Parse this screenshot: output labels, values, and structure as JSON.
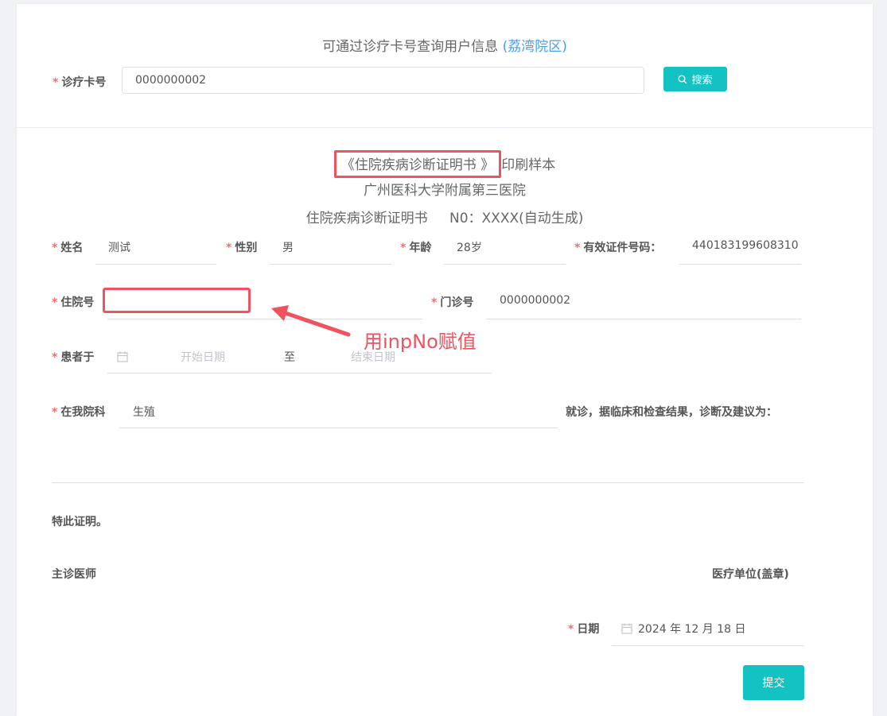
{
  "search": {
    "hint_text": "可通过诊疗卡号查询用户信息",
    "campus": "(荔湾院区)",
    "card_label": "诊疗卡号",
    "card_value": "0000000002",
    "search_label": "搜索"
  },
  "document": {
    "sample_title_highlight": "《住院疾病诊断证明书 》",
    "sample_title_suffix": "印刷样本",
    "hospital_name": "广州医科大学附属第三医院",
    "cert_name": "住院疾病诊断证明书",
    "cert_no": "N0：XXXX(自动生成)"
  },
  "form": {
    "name_label": "姓名",
    "name_value": "测试",
    "gender_label": "性别",
    "gender_value": "男",
    "age_label": "年龄",
    "age_value": "28岁",
    "id_label": "有效证件号码：",
    "id_value": "440183199608310",
    "inpatient_label": "住院号",
    "inpatient_value": "",
    "outpatient_label": "门诊号",
    "outpatient_value": "0000000002",
    "patient_label": "患者于",
    "start_placeholder": "开始日期",
    "range_sep": "至",
    "end_placeholder": "结束日期",
    "dept_label": "在我院科",
    "dept_value": "生殖",
    "diagnosis_text": "就诊，据临床和检查结果，诊断及建议为：",
    "certify_text": "特此证明。",
    "doctor_label": "主诊医师",
    "unit_label": "医疗单位(盖章)",
    "date_label": "日期",
    "date_value": "2024 年 12 月 18 日",
    "submit_label": "提交"
  },
  "annotation": {
    "text": "用inpNo赋值",
    "color": "#f0525f"
  },
  "colors": {
    "accent": "#13c2c2",
    "link": "#409eff",
    "required": "#f56c6c"
  }
}
